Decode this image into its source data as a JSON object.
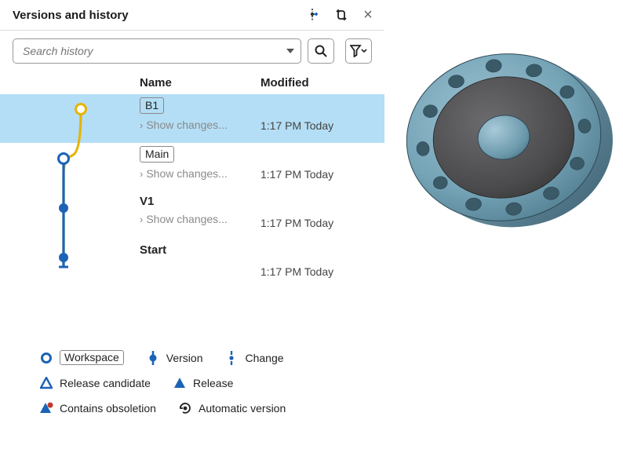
{
  "panel": {
    "title": "Versions and history",
    "search_placeholder": "Search history"
  },
  "table": {
    "header": {
      "name": "Name",
      "modified": "Modified"
    }
  },
  "rows": [
    {
      "id": "b1",
      "label": "B1",
      "badge": true,
      "show_changes": "Show changes...",
      "modified": "1:17 PM Today",
      "selected": true
    },
    {
      "id": "main",
      "label": "Main",
      "badge": true,
      "show_changes": "Show changes...",
      "modified": "1:17 PM Today",
      "selected": false
    },
    {
      "id": "v1",
      "label": "V1",
      "badge": false,
      "show_changes": "Show changes...",
      "modified": "1:17 PM Today",
      "selected": false
    },
    {
      "id": "start",
      "label": "Start",
      "badge": false,
      "show_changes": "",
      "modified": "1:17 PM Today",
      "selected": false
    }
  ],
  "legend": {
    "workspace": "Workspace",
    "version": "Version",
    "change": "Change",
    "release_candidate": "Release candidate",
    "release": "Release",
    "contains_obsoletion": "Contains obsoletion",
    "automatic_version": "Automatic version"
  },
  "colors": {
    "accent_blue": "#1c63b7",
    "highlight_row": "#b4def5",
    "branch_yellow": "#e7b400",
    "part_blue": "#75a4b7",
    "part_dark": "#4a4a4c"
  }
}
